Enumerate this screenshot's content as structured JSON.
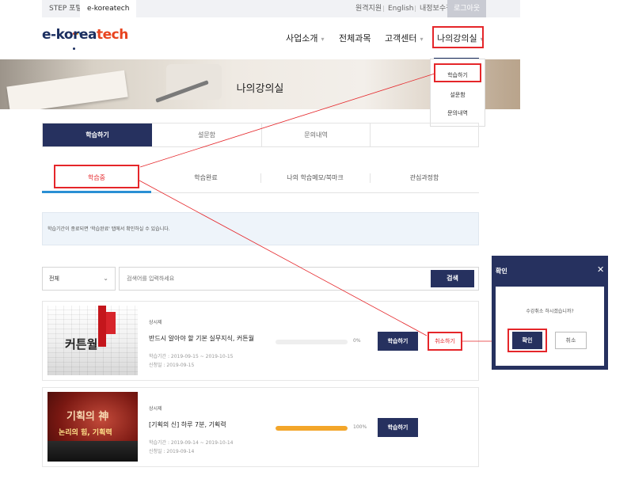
{
  "topbar": {
    "site_tabs": [
      "STEP 포털",
      "e-koreatech"
    ],
    "links": [
      "원격지원",
      "English",
      "내정보수정"
    ],
    "logout": "로그아웃"
  },
  "logo": {
    "prefix": "e-korea",
    "suffix": "tech",
    "dot_colors": [
      "#e8441f",
      "#f3a62a",
      "#2a8fd4",
      "#1c2f60"
    ]
  },
  "gnb": [
    "사업소개",
    "전체과목",
    "고객센터",
    "나의강의실"
  ],
  "dropdown": [
    "학습하기",
    "설문함",
    "문의내역"
  ],
  "banner_title": "나의강의실",
  "main_tabs": [
    "학습하기",
    "설문함",
    "문의내역",
    ""
  ],
  "sub_tabs": [
    "학습중",
    "학습완료",
    "나의 학습메모/북마크",
    "관심과정함"
  ],
  "info_text": "학습기간이 종료되면 '학습완료' 탭에서 확인하실 수 있습니다.",
  "search": {
    "select_value": "전체",
    "placeholder": "검색어를 입력하세요",
    "button": "검색"
  },
  "courses": [
    {
      "category": "상시제",
      "title": "반드시 알아야 할 기본 실무지식, 커튼월",
      "period": "학습기간 : 2019-09-15 ~ 2019-10-15",
      "applied": "신청일 : 2019-09-15",
      "progress_pct": 0,
      "progress_label": "0%",
      "learn_button": "학습하기",
      "cancel_button": "취소하기",
      "thumb_title": "커튼월"
    },
    {
      "category": "상시제",
      "title": "[기획의 신] 하루 7분, 기획력",
      "period": "학습기간 : 2019-09-14 ~ 2019-10-14",
      "applied": "신청일 : 2019-09-14",
      "progress_pct": 100,
      "progress_label": "100%",
      "learn_button": "학습하기",
      "thumb_title": "기획의 神",
      "thumb_subtitle": "논리의 힘, 기획력"
    }
  ],
  "modal": {
    "title": "확인",
    "message": "수강취소 하시겠습니까?",
    "ok": "확인",
    "cancel": "취소"
  },
  "colors": {
    "navy": "#26315f",
    "highlight": "#e5262a",
    "progress": "#f3a62a",
    "tab_underline": "#2a8fd4"
  }
}
